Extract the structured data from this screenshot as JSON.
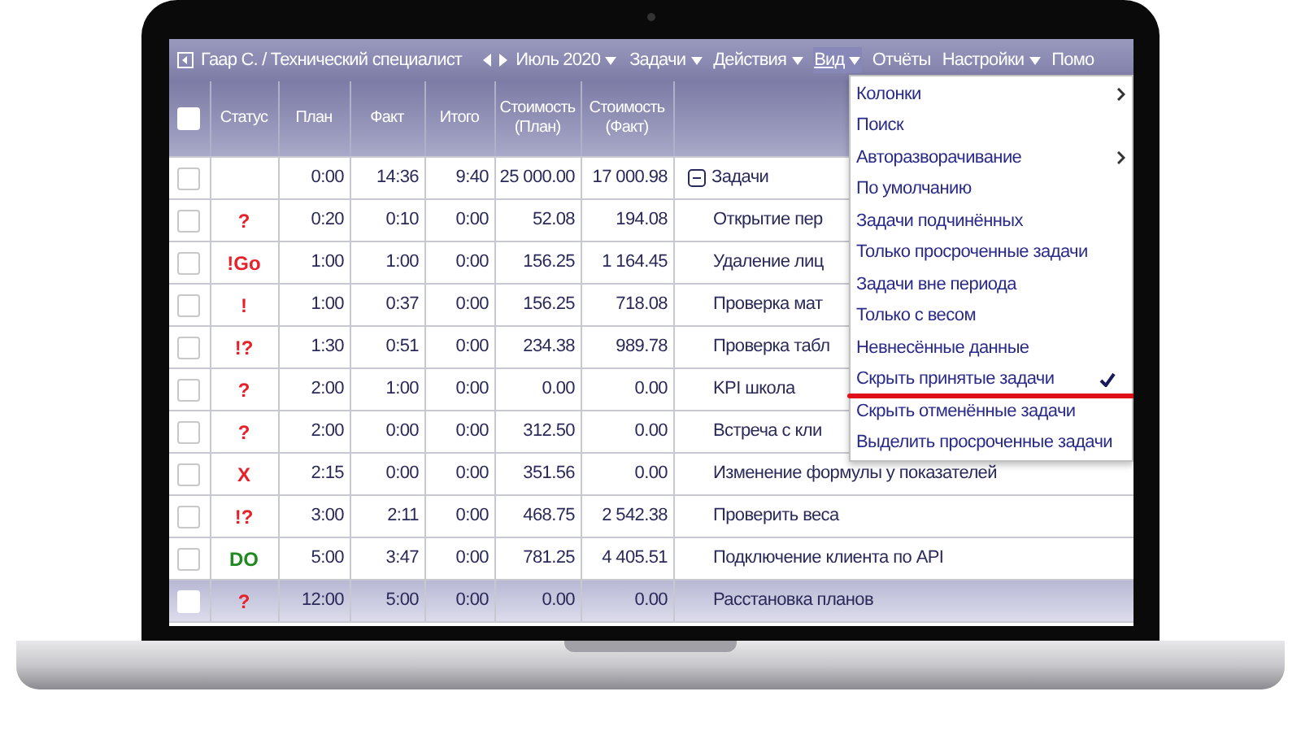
{
  "toolbar": {
    "user": "Гаар С. / Технический специалист",
    "period": "Июль 2020",
    "menus": [
      {
        "label": "Задачи",
        "caret": true,
        "selected": false
      },
      {
        "label": "Действия",
        "caret": true,
        "selected": false
      },
      {
        "label": "Вид",
        "caret": true,
        "selected": true
      },
      {
        "label": "Отчёты",
        "caret": false,
        "selected": false
      },
      {
        "label": "Настройки",
        "caret": true,
        "selected": false
      },
      {
        "label": "Помо",
        "caret": false,
        "selected": false
      }
    ]
  },
  "table": {
    "columns": [
      "Статус",
      "План",
      "Факт",
      "Итого",
      "Стоимость (План)",
      "Стоимость (Факт)"
    ],
    "header_checked": false,
    "rows": [
      {
        "checked": false,
        "selected": false,
        "kind": "group",
        "status": "",
        "plan": "0:00",
        "fact": "14:36",
        "total": "9:40",
        "cost_plan": "25 000.00",
        "cost_fact": "17 000.98",
        "name": "Задачи",
        "expanded": true
      },
      {
        "checked": false,
        "selected": false,
        "kind": "task",
        "status": "?",
        "color": "#e8202a",
        "plan": "0:20",
        "fact": "0:10",
        "total": "0:00",
        "cost_plan": "52.08",
        "cost_fact": "194.08",
        "name": "Открытие пер"
      },
      {
        "checked": false,
        "selected": false,
        "kind": "task",
        "status": "!Go",
        "color": "#e8202a",
        "plan": "1:00",
        "fact": "1:00",
        "total": "0:00",
        "cost_plan": "156.25",
        "cost_fact": "1 164.45",
        "name": "Удаление лиц"
      },
      {
        "checked": false,
        "selected": false,
        "kind": "task",
        "status": "!",
        "color": "#e8202a",
        "plan": "1:00",
        "fact": "0:37",
        "total": "0:00",
        "cost_plan": "156.25",
        "cost_fact": "718.08",
        "name": "Проверка мат"
      },
      {
        "checked": false,
        "selected": false,
        "kind": "task",
        "status": "!?",
        "color": "#e8202a",
        "plan": "1:30",
        "fact": "0:51",
        "total": "0:00",
        "cost_plan": "234.38",
        "cost_fact": "989.78",
        "name": "Проверка табл"
      },
      {
        "checked": false,
        "selected": false,
        "kind": "task",
        "status": "?",
        "color": "#e8202a",
        "plan": "2:00",
        "fact": "1:00",
        "total": "0:00",
        "cost_plan": "0.00",
        "cost_fact": "0.00",
        "name": "KPI школа"
      },
      {
        "checked": false,
        "selected": false,
        "kind": "task",
        "status": "?",
        "color": "#e8202a",
        "plan": "2:00",
        "fact": "0:00",
        "total": "0:00",
        "cost_plan": "312.50",
        "cost_fact": "0.00",
        "name": "Встреча с кли"
      },
      {
        "checked": false,
        "selected": false,
        "kind": "task",
        "status": "X",
        "color": "#e8202a",
        "plan": "2:15",
        "fact": "0:00",
        "total": "0:00",
        "cost_plan": "351.56",
        "cost_fact": "0.00",
        "name": "Изменение формулы у показателей"
      },
      {
        "checked": false,
        "selected": false,
        "kind": "task",
        "status": "!?",
        "color": "#e8202a",
        "plan": "3:00",
        "fact": "2:11",
        "total": "0:00",
        "cost_plan": "468.75",
        "cost_fact": "2 542.38",
        "name": "Проверить веса"
      },
      {
        "checked": false,
        "selected": false,
        "kind": "task",
        "status": "DO",
        "color": "#1f8a1f",
        "plan": "5:00",
        "fact": "3:47",
        "total": "0:00",
        "cost_plan": "781.25",
        "cost_fact": "4 405.51",
        "name": "Подключение клиента по API"
      },
      {
        "checked": false,
        "selected": true,
        "kind": "task",
        "status": "?",
        "color": "#e8202a",
        "plan": "12:00",
        "fact": "5:00",
        "total": "0:00",
        "cost_plan": "0.00",
        "cost_fact": "0.00",
        "name": "Расстановка планов"
      }
    ]
  },
  "view_menu": {
    "items": [
      {
        "label": "Колонки",
        "submenu": true,
        "checked": false,
        "underlined": false
      },
      {
        "label": "Поиск",
        "submenu": false,
        "checked": false,
        "underlined": false
      },
      {
        "label": "Авторазворачивание",
        "submenu": true,
        "checked": false,
        "underlined": false
      },
      {
        "label": "По умолчанию",
        "submenu": false,
        "checked": false,
        "underlined": false
      },
      {
        "label": "Задачи подчинённых",
        "submenu": false,
        "checked": false,
        "underlined": false
      },
      {
        "label": "Только просроченные задачи",
        "submenu": false,
        "checked": false,
        "underlined": false
      },
      {
        "label": "Задачи вне периода",
        "submenu": false,
        "checked": false,
        "underlined": false
      },
      {
        "label": "Только с весом",
        "submenu": false,
        "checked": false,
        "underlined": false
      },
      {
        "label": "Невнесённые данные",
        "submenu": false,
        "checked": false,
        "underlined": false
      },
      {
        "label": "Скрыть принятые задачи",
        "submenu": false,
        "checked": true,
        "underlined": true
      },
      {
        "label": "Скрыть отменённые задачи",
        "submenu": false,
        "checked": false,
        "underlined": false
      },
      {
        "label": "Выделить просроченные задачи",
        "submenu": false,
        "checked": false,
        "underlined": false
      }
    ]
  }
}
